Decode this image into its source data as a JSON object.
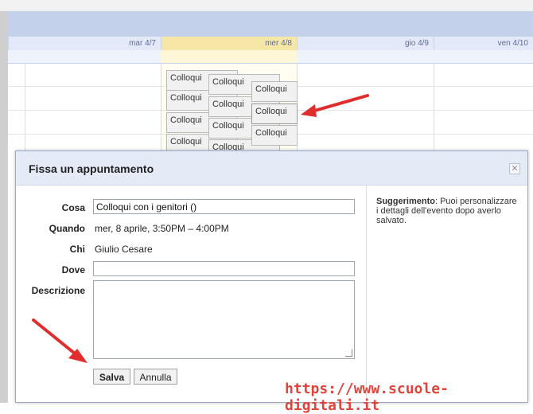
{
  "calendar": {
    "days": [
      "mar 4/7",
      "mer 4/8",
      "gio 4/9",
      "ven 4/10"
    ],
    "events": [
      "Colloqui",
      "Colloqui",
      "Colloqui",
      "Colloqui",
      "Colloqui",
      "Colloqui",
      "Colloqui",
      "Colloqui",
      "Colloqui",
      "Colloqui",
      "Colloqui"
    ]
  },
  "dialog": {
    "title": "Fissa un appuntamento",
    "close_icon": "close-icon",
    "fields": {
      "cosa_label": "Cosa",
      "cosa_value": "Colloqui con i genitori ()",
      "quando_label": "Quando",
      "quando_value": "mer, 8 aprile, 3:50PM – 4:00PM",
      "chi_label": "Chi",
      "chi_value": "Giulio Cesare",
      "dove_label": "Dove",
      "dove_value": "",
      "descrizione_label": "Descrizione",
      "descrizione_value": ""
    },
    "buttons": {
      "save": "Salva",
      "cancel": "Annulla"
    },
    "hint": {
      "bold": "Suggerimento",
      "text": ": Puoi personalizzare i dettagli dell'evento dopo averlo salvato."
    }
  },
  "watermark": "https://www.scuole-digitali.it",
  "colors": {
    "arrow": "#e02d2d",
    "watermark": "#e0443b",
    "dialog_header": "#e4ebf7"
  }
}
